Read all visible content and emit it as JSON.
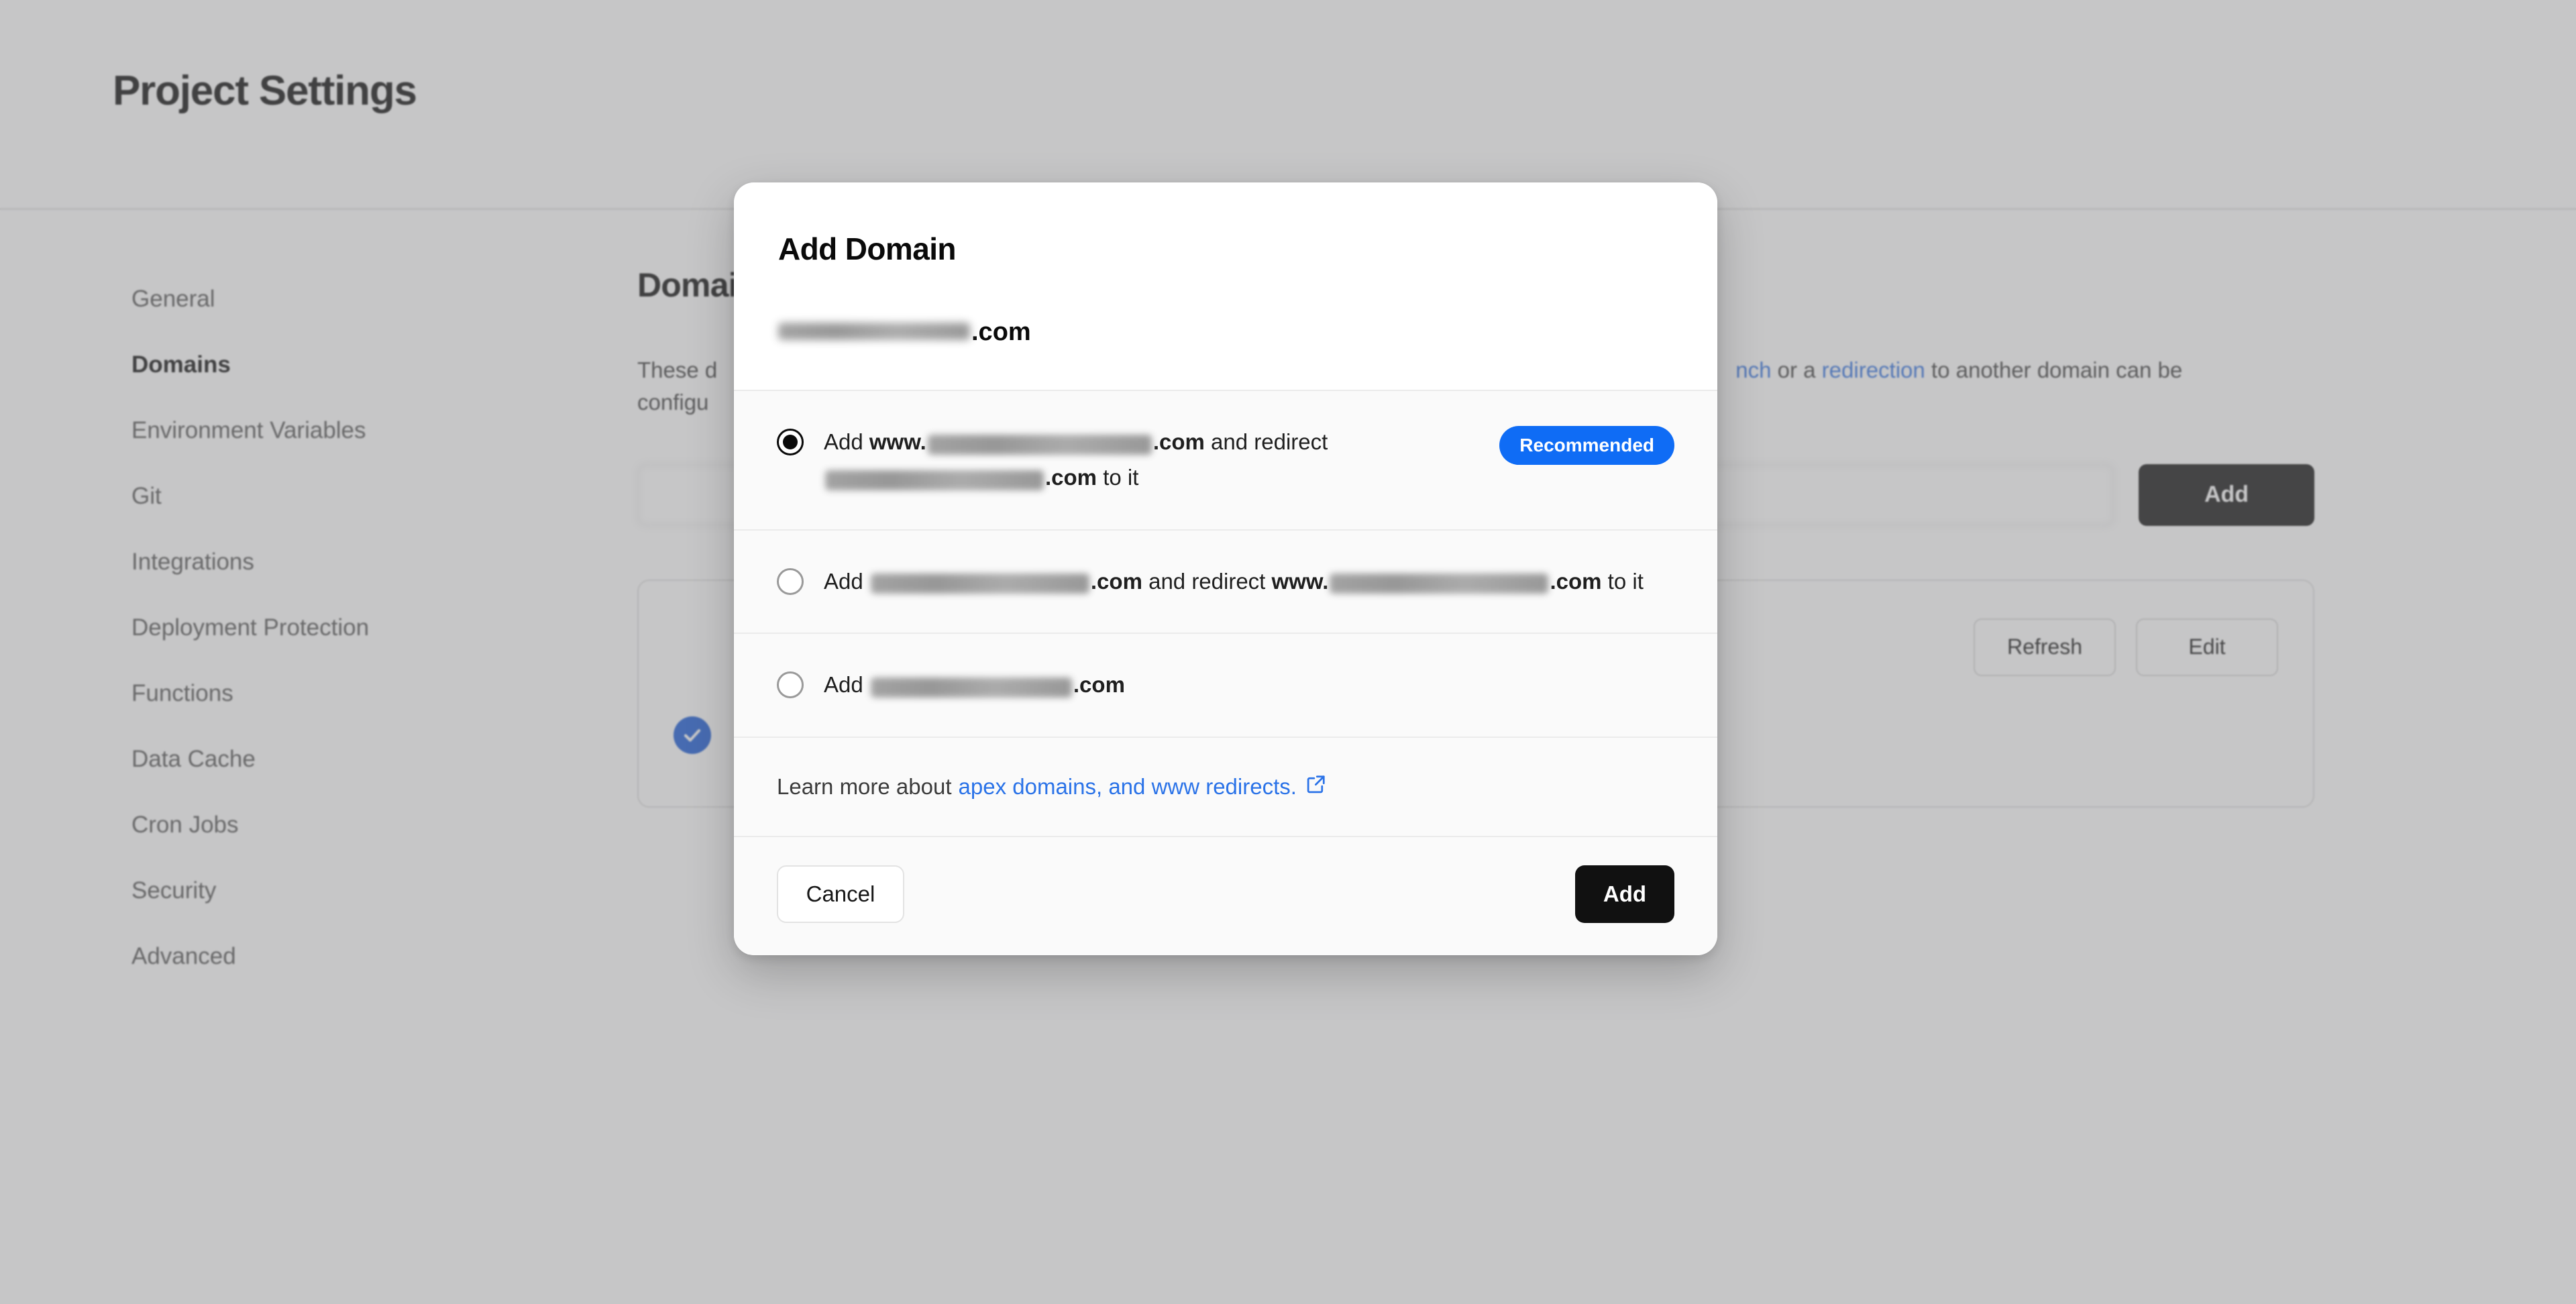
{
  "page": {
    "title": "Project Settings"
  },
  "sidebar": {
    "items": [
      {
        "label": "General",
        "active": false
      },
      {
        "label": "Domains",
        "active": true
      },
      {
        "label": "Environment Variables",
        "active": false
      },
      {
        "label": "Git",
        "active": false
      },
      {
        "label": "Integrations",
        "active": false
      },
      {
        "label": "Deployment Protection",
        "active": false
      },
      {
        "label": "Functions",
        "active": false
      },
      {
        "label": "Data Cache",
        "active": false
      },
      {
        "label": "Cron Jobs",
        "active": false
      },
      {
        "label": "Security",
        "active": false
      },
      {
        "label": "Advanced",
        "active": false
      }
    ]
  },
  "main": {
    "section_title": "Domains",
    "desc_prefix": "These d",
    "desc_line2": "configu",
    "desc_tail_link1": "nch",
    "desc_tail_mid": " or a ",
    "desc_tail_link2": "redirection",
    "desc_tail_end": " to another domain can be",
    "input_placeholder": "",
    "input_value": "",
    "add_label": "Add",
    "card": {
      "domain_name": "",
      "refresh_label": "Refresh",
      "edit_label": "Edit",
      "status_text": ""
    }
  },
  "modal": {
    "title": "Add Domain",
    "domain_suffix": ".com",
    "options": [
      {
        "id": "www-redirect-apex",
        "selected": true,
        "prefix": "Add ",
        "www_label": "www.",
        "suffix_1": ".com",
        "middle": " and redirect ",
        "suffix_2": ".com",
        "tail": " to it",
        "badge": "Recommended"
      },
      {
        "id": "apex-redirect-www",
        "selected": false,
        "prefix": "Add ",
        "suffix_1": ".com",
        "middle": " and redirect ",
        "www_label": "www.",
        "suffix_2": ".com",
        "tail": " to it",
        "badge": ""
      },
      {
        "id": "apex-only",
        "selected": false,
        "prefix": "Add ",
        "suffix_1": ".com",
        "badge": ""
      }
    ],
    "learn_more": {
      "text": "Learn more about",
      "link_text": "apex domains, and www redirects.",
      "icon": "external-link-icon"
    },
    "footer": {
      "cancel_label": "Cancel",
      "add_label": "Add"
    }
  },
  "colors": {
    "accent_blue": "#0f6cf5",
    "link_blue": "#2b73e8",
    "dark_button": "#111111",
    "status_blue": "#1558d6"
  }
}
